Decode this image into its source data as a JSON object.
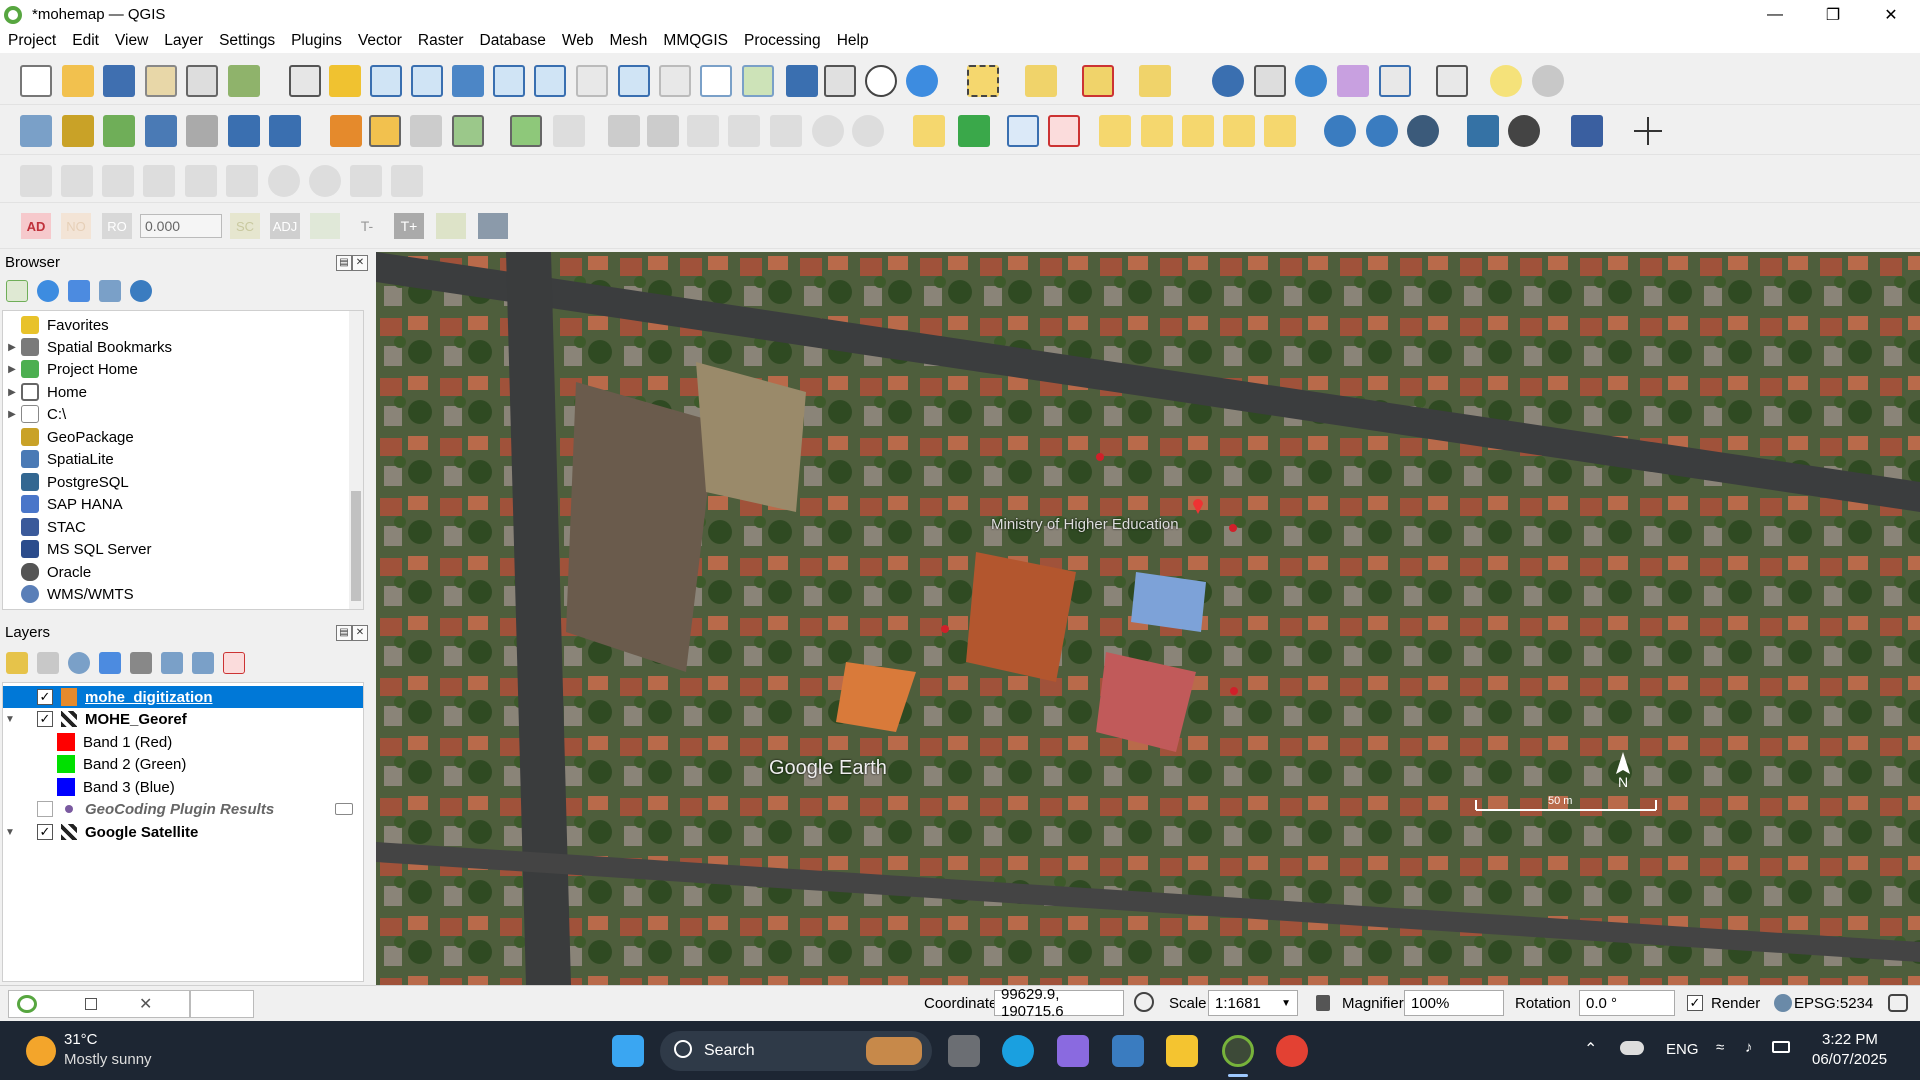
{
  "window": {
    "title": "*mohemap — QGIS"
  },
  "menu": [
    "Project",
    "Edit",
    "View",
    "Layer",
    "Settings",
    "Plugins",
    "Vector",
    "Raster",
    "Database",
    "Web",
    "Mesh",
    "MMQGIS",
    "Processing",
    "Help"
  ],
  "advanced_digitizing": {
    "ad": "AD",
    "no": "NO",
    "ro": "RO",
    "value": "0.000",
    "sc": "SC",
    "adj": "ADJ",
    "tminus": "T-",
    "tplus": "T+"
  },
  "browser": {
    "title": "Browser",
    "items": [
      {
        "label": "Favorites",
        "arrow": false,
        "color": "#e8c22a"
      },
      {
        "label": "Spatial Bookmarks",
        "arrow": true,
        "color": "#7a7a7a"
      },
      {
        "label": "Project Home",
        "arrow": true,
        "color": "#4caf50"
      },
      {
        "label": "Home",
        "arrow": true,
        "color": "#666"
      },
      {
        "label": "C:\\",
        "arrow": true,
        "color": "#888"
      },
      {
        "label": "GeoPackage",
        "arrow": false,
        "color": "#c9a227"
      },
      {
        "label": "SpatiaLite",
        "arrow": false,
        "color": "#4a7ab5"
      },
      {
        "label": "PostgreSQL",
        "arrow": false,
        "color": "#336791"
      },
      {
        "label": "SAP HANA",
        "arrow": false,
        "color": "#4a76c9"
      },
      {
        "label": "STAC",
        "arrow": false,
        "color": "#3b5a9a"
      },
      {
        "label": "MS SQL Server",
        "arrow": false,
        "color": "#2b4c8c"
      },
      {
        "label": "Oracle",
        "arrow": false,
        "color": "#555"
      },
      {
        "label": "WMS/WMTS",
        "arrow": false,
        "color": "#5a7fb8"
      }
    ]
  },
  "layers": {
    "title": "Layers",
    "items": [
      {
        "label": "mohe_digitization",
        "checked": true,
        "selected": true
      },
      {
        "label": "MOHE_Georef",
        "checked": true,
        "selected": false
      },
      {
        "label": "Band 1 (Red)",
        "color": "#ff0000"
      },
      {
        "label": "Band 2 (Green)",
        "color": "#00e000"
      },
      {
        "label": "Band 3 (Blue)",
        "color": "#0000ff"
      },
      {
        "label": "GeoCoding Plugin Results",
        "checked": false
      },
      {
        "label": "Google Satellite",
        "checked": true
      }
    ]
  },
  "map": {
    "label_ministry": "Ministry of Higher Education",
    "watermark": "Google Earth",
    "north": "N",
    "scalebar_text": "50 m"
  },
  "status": {
    "coordinate_label": "Coordinate",
    "coordinate_value": "99629.9, 190715.6",
    "scale_label": "Scale",
    "scale_value": "1:1681",
    "magnifier_label": "Magnifier",
    "magnifier_value": "100%",
    "rotation_label": "Rotation",
    "rotation_value": "0.0 °",
    "render_label": "Render",
    "crs": "EPSG:5234"
  },
  "taskbar": {
    "temp": "31°C",
    "weather": "Mostly sunny",
    "search": "Search",
    "lang": "ENG",
    "time": "3:22 PM",
    "date": "06/07/2025"
  }
}
